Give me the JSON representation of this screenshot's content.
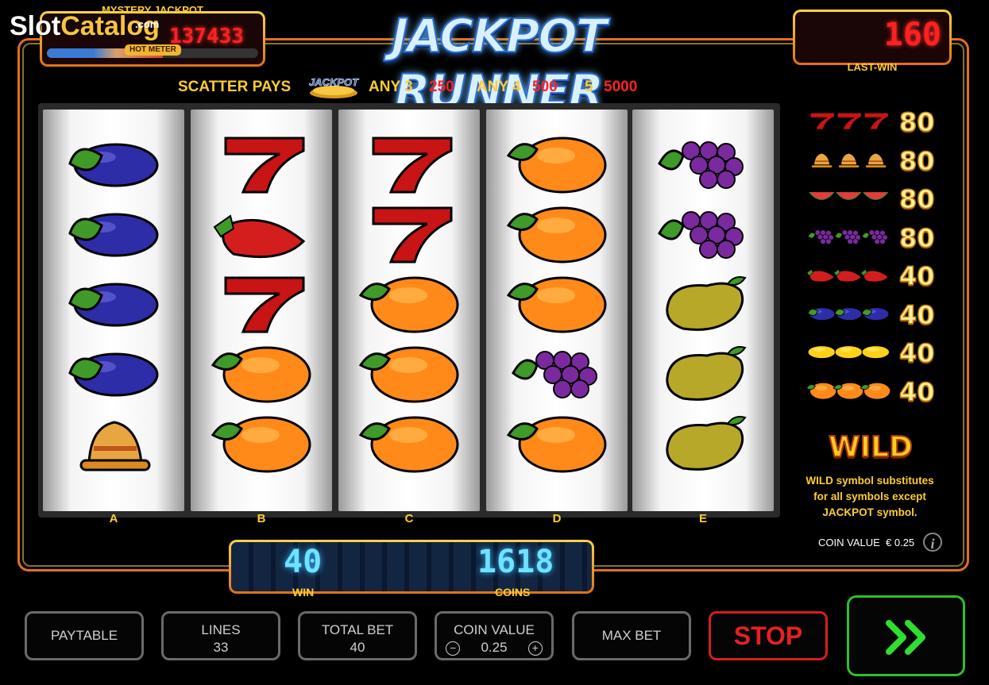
{
  "watermark": {
    "part1": "Slot",
    "part2": "Catalog",
    "part3": ".com"
  },
  "game_title": "JACKPOT RUNNER",
  "mystery_jackpot": {
    "label": "MYSTERY JACKPOT",
    "value": "137433",
    "hot_meter_label": "HOT METER",
    "hot_meter_level": 0.55
  },
  "last_win": {
    "label": "LAST-WIN",
    "value": "160"
  },
  "scatter": {
    "label": "SCATTER PAYS",
    "symbol_label": "JACKPOT",
    "pays": [
      {
        "combo": "ANY 3",
        "value": "250"
      },
      {
        "combo": "ANY 4",
        "value": "500"
      },
      {
        "combo": "5",
        "value": "5000"
      }
    ]
  },
  "reels": [
    {
      "label": "A",
      "symbols": [
        "plum",
        "plum",
        "plum",
        "plum",
        "bell"
      ]
    },
    {
      "label": "B",
      "symbols": [
        "seven",
        "strawberry",
        "seven",
        "orange",
        "orange"
      ]
    },
    {
      "label": "C",
      "symbols": [
        "seven",
        "seven",
        "orange",
        "orange",
        "orange"
      ]
    },
    {
      "label": "D",
      "symbols": [
        "orange",
        "orange",
        "orange",
        "grapes",
        "orange"
      ]
    },
    {
      "label": "E",
      "symbols": [
        "grapes",
        "grapes",
        "pear",
        "pear",
        "pear"
      ]
    }
  ],
  "paytable": [
    {
      "symbol": "seven",
      "value": "80"
    },
    {
      "symbol": "bell",
      "value": "80"
    },
    {
      "symbol": "watermelon",
      "value": "80"
    },
    {
      "symbol": "grapes",
      "value": "80"
    },
    {
      "symbol": "strawberry",
      "value": "40"
    },
    {
      "symbol": "plum",
      "value": "40"
    },
    {
      "symbol": "lemon",
      "value": "40"
    },
    {
      "symbol": "orange",
      "value": "40"
    }
  ],
  "wild": {
    "logo": "WILD",
    "line1": "WILD symbol substitutes",
    "line2": "for all symbols except",
    "line3": "JACKPOT symbol."
  },
  "coin_value_info": {
    "label": "COIN VALUE",
    "value": "€ 0.25",
    "icon": "info-icon"
  },
  "win_display": {
    "win_value": "40",
    "win_label": "WIN",
    "coins_value": "1618",
    "coins_label": "COINS"
  },
  "buttons": {
    "paytable": "PAYTABLE",
    "lines_label": "LINES",
    "lines_value": "33",
    "total_bet_label": "TOTAL BET",
    "total_bet_value": "40",
    "coin_value_label": "COIN VALUE",
    "coin_value_value": "0.25",
    "minus": "−",
    "plus": "+",
    "max_bet": "MAX BET",
    "stop": "STOP",
    "spin_icon": "double-chevron-right-icon"
  },
  "colors": {
    "accent_orange": "#e0701c",
    "gold": "#ffcc33",
    "red": "#ff2222",
    "green": "#2fbf2f",
    "digits_blue": "#6ee3ff"
  }
}
